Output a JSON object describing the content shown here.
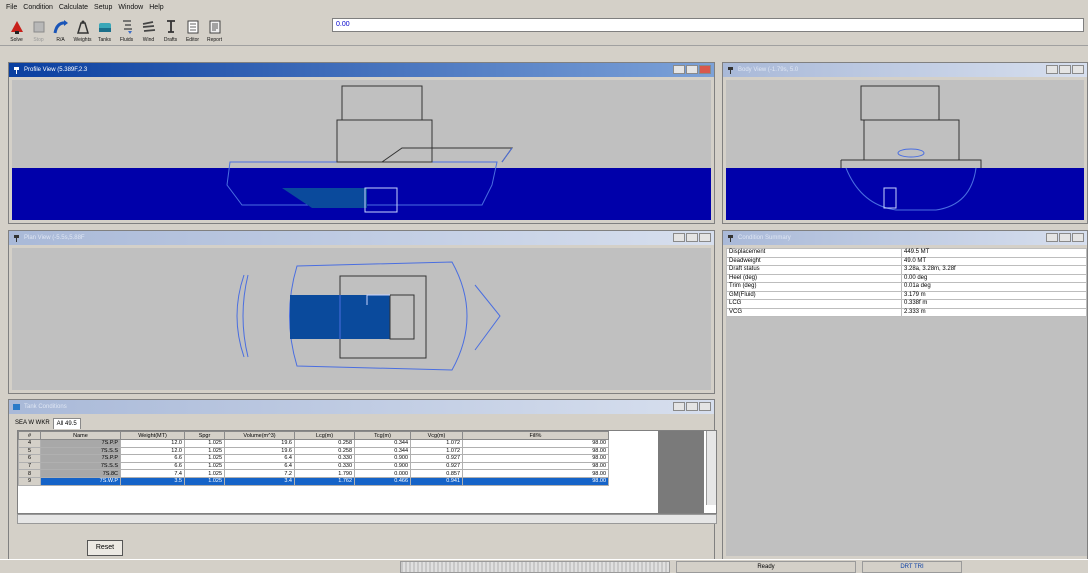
{
  "menu": [
    "File",
    "Condition",
    "Calculate",
    "Setup",
    "Window",
    "Help"
  ],
  "toolbar": {
    "buttons": [
      {
        "label": "Solve",
        "icon": "solve-icon",
        "enabled": true
      },
      {
        "label": "Stop",
        "icon": "stop-icon",
        "enabled": false
      },
      {
        "label": "R/A",
        "icon": "righting-arm-icon",
        "enabled": true
      },
      {
        "label": "Weights",
        "icon": "weights-icon",
        "enabled": true
      },
      {
        "label": "Tanks",
        "icon": "tanks-icon",
        "enabled": true
      },
      {
        "label": "Fluids",
        "icon": "fluids-icon",
        "enabled": true
      },
      {
        "label": "Wind",
        "icon": "wind-icon",
        "enabled": true
      },
      {
        "label": "Drafts",
        "icon": "drafts-icon",
        "enabled": true
      },
      {
        "label": "Editor",
        "icon": "editor-icon",
        "enabled": true
      },
      {
        "label": "Report",
        "icon": "report-icon",
        "enabled": true
      }
    ],
    "status_value": "0.00"
  },
  "windows": {
    "profile": {
      "title": "Profile View (5.389F,2.3"
    },
    "body": {
      "title": "Body View (-1.79s, 5.0"
    },
    "plan": {
      "title": "Plan View (-5.5s,5.88F"
    },
    "properties": {
      "title": "Condition Summary"
    },
    "tanks": {
      "title": "Tank Conditions"
    }
  },
  "properties": [
    {
      "label": "Displacement",
      "value": "449.5 MT"
    },
    {
      "label": "Deadweight",
      "value": "49.0 MT"
    },
    {
      "label": "Draft status",
      "value": "3.28a, 3.28m, 3.28f"
    },
    {
      "label": "Heel (deg)",
      "value": "0.00 deg"
    },
    {
      "label": "Trim (deg)",
      "value": "0.01a deg"
    },
    {
      "label": "GM(Fluid)",
      "value": "3.179 m"
    },
    {
      "label": "LCG",
      "value": "0.338f m"
    },
    {
      "label": "VCG",
      "value": "2.333 m"
    }
  ],
  "tanks": {
    "tab_prefix": "SEA W WKR",
    "tab_label": "All 49.5",
    "columns": [
      "#",
      "Name",
      "Weight(MT)",
      "Spgr",
      "Volume(m^3)",
      "Lcg(m)",
      "Tcg(m)",
      "Vcg(m)",
      "Fill%"
    ],
    "rows": [
      {
        "n": "4",
        "name": "7S.P.P",
        "weight": "12.0",
        "spgr": "1.025",
        "volume": "19.6",
        "lcg": "0.258",
        "tcg": "0.344",
        "vcg": "1.072",
        "fill": "98.00"
      },
      {
        "n": "5",
        "name": "7S.S.S",
        "weight": "12.0",
        "spgr": "1.025",
        "volume": "19.6",
        "lcg": "0.258",
        "tcg": "0.344",
        "vcg": "1.072",
        "fill": "98.00"
      },
      {
        "n": "6",
        "name": "7S.P.P",
        "weight": "6.6",
        "spgr": "1.025",
        "volume": "6.4",
        "lcg": "0.330",
        "tcg": "0.900",
        "vcg": "0.927",
        "fill": "98.00"
      },
      {
        "n": "7",
        "name": "7S.S.S",
        "weight": "6.6",
        "spgr": "1.025",
        "volume": "6.4",
        "lcg": "0.330",
        "tcg": "0.900",
        "vcg": "0.927",
        "fill": "98.00"
      },
      {
        "n": "8",
        "name": "7S.8C",
        "weight": "7.4",
        "spgr": "1.025",
        "volume": "7.2",
        "lcg": "1.790",
        "tcg": "0.000",
        "vcg": "0.857",
        "fill": "98.00"
      },
      {
        "n": "9",
        "name": "7S.W.P",
        "weight": "3.5",
        "spgr": "1.025",
        "volume": "3.4",
        "lcg": "1.762",
        "tcg": "0.466",
        "vcg": "0.941",
        "fill": "98.00"
      }
    ],
    "selected_row": 5,
    "reset_label": "Reset"
  },
  "statusbar": {
    "ready": "Ready",
    "mode": "DRT TRI"
  },
  "colors": {
    "water": "#0000aa",
    "tank_fill": "#0a4a9c",
    "hull_line": "#3a5bd0",
    "title_active": "#0a3fa0",
    "selection": "#1563c8"
  }
}
